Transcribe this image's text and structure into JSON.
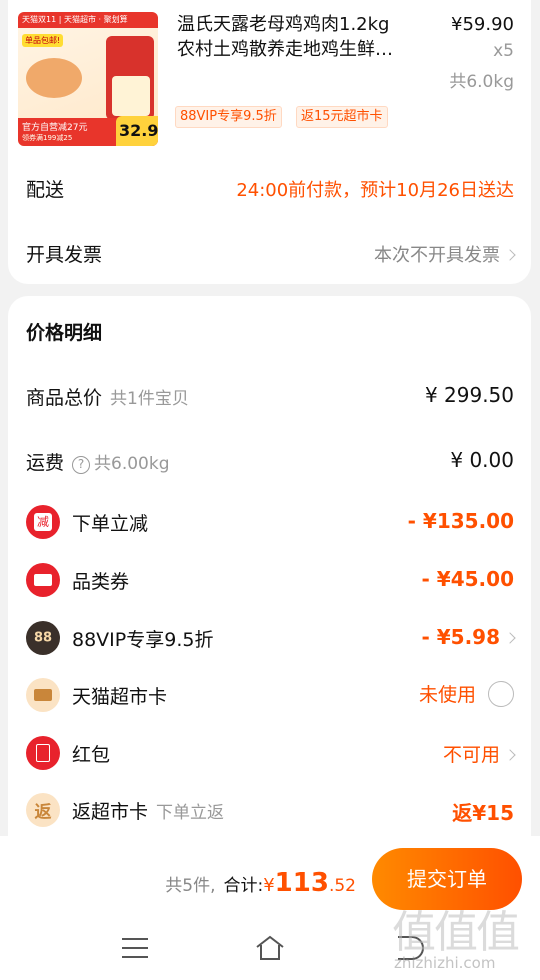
{
  "product": {
    "image_texts": {
      "top_band": "天猫双11 | 天猫超市 · 聚划算",
      "badge": "单品包邮!",
      "bottom_line1": "官方自营减27元",
      "bottom_line2": "领券满199减25",
      "price_badge": "32.9"
    },
    "title_line1": "温氏天露老母鸡鸡肉1.2kg",
    "title_line2": "农村土鸡散养走地鸡生鲜…",
    "price": "¥59.90",
    "quantity": "x5",
    "weight": "共6.0kg",
    "tags": [
      "88VIP专享9.5折",
      "返15元超市卡"
    ]
  },
  "delivery": {
    "label": "配送",
    "value": "24:00前付款，预计10月26日送达"
  },
  "invoice": {
    "label": "开具发票",
    "value": "本次不开具发票"
  },
  "price_details": {
    "title": "价格明细",
    "total": {
      "label": "商品总价",
      "sub": "共1件宝贝",
      "value": "¥ 299.50"
    },
    "shipping": {
      "label": "运费",
      "help": "?",
      "sub": "共6.00kg",
      "value": "¥ 0.00"
    },
    "discounts": [
      {
        "icon": "coupon-reduce-icon",
        "label": "下单立减",
        "value": "- ¥135.00",
        "color": "#ff5000"
      },
      {
        "icon": "ticket-icon",
        "label": "品类券",
        "value": "- ¥45.00",
        "color": "#ff5000"
      },
      {
        "icon": "88vip-icon",
        "label": "88VIP专享9.5折",
        "value": "- ¥5.98",
        "color": "#ff5000"
      },
      {
        "icon": "card-icon",
        "label": "天猫超市卡",
        "value": "未使用",
        "color": "#ff5000"
      },
      {
        "icon": "red-packet-icon",
        "label": "红包",
        "value": "不可用",
        "color": "#ff5000"
      },
      {
        "icon": "return-icon",
        "label": "返超市卡",
        "sub": "下单立返",
        "value": "返¥15",
        "color": "#ff5000",
        "icon_glyph": "返"
      }
    ]
  },
  "footer": {
    "count": "共5件,",
    "total_label": "合计:",
    "currency": "¥",
    "total_int": "113",
    "total_dec": ".52",
    "submit": "提交订单"
  },
  "watermark": {
    "glyphs": "值值值",
    "url": "zhizhizhi.com"
  },
  "colors": {
    "accent": "#ff5000",
    "submit_start": "#ff8a00",
    "submit_end": "#ff5000"
  }
}
